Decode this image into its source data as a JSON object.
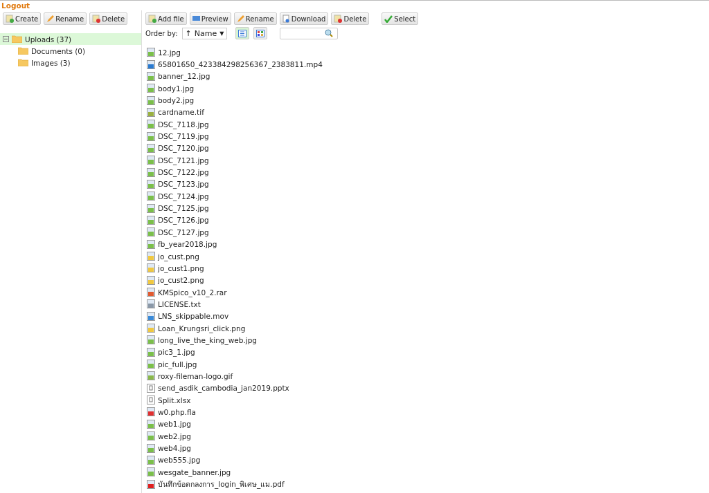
{
  "logout": "Logout",
  "dir_toolbar": [
    {
      "kind": "create",
      "label": "Create"
    },
    {
      "kind": "rename",
      "label": "Rename"
    },
    {
      "kind": "delete",
      "label": "Delete"
    }
  ],
  "tree": [
    {
      "label": "Uploads (37)",
      "selected": true,
      "expanded": true,
      "children": [
        {
          "label": "Documents (0)",
          "selected": false
        },
        {
          "label": "Images (3)",
          "selected": false
        }
      ]
    }
  ],
  "file_toolbar": [
    {
      "kind": "add",
      "label": "Add file"
    },
    {
      "kind": "preview",
      "label": "Preview"
    },
    {
      "kind": "rename",
      "label": "Rename"
    },
    {
      "kind": "download",
      "label": "Download"
    },
    {
      "kind": "delete",
      "label": "Delete"
    },
    {
      "kind": "select",
      "label": "Select"
    }
  ],
  "order": {
    "label": "Order by:",
    "arrow": "↑",
    "value": "Name",
    "caret": "▼"
  },
  "views": [
    {
      "kind": "list",
      "selected": true
    },
    {
      "kind": "thumbs",
      "selected": false
    }
  ],
  "files": [
    {
      "name": "12.jpg",
      "kind": "image"
    },
    {
      "name": "65801650_423384298256367_2383811.mp4",
      "kind": "video"
    },
    {
      "name": "banner_12.jpg",
      "kind": "image"
    },
    {
      "name": "body1.jpg",
      "kind": "image"
    },
    {
      "name": "body2.jpg",
      "kind": "image"
    },
    {
      "name": "cardname.tif",
      "kind": "tif"
    },
    {
      "name": "DSC_7118.jpg",
      "kind": "image"
    },
    {
      "name": "DSC_7119.jpg",
      "kind": "image"
    },
    {
      "name": "DSC_7120.jpg",
      "kind": "image"
    },
    {
      "name": "DSC_7121.jpg",
      "kind": "image"
    },
    {
      "name": "DSC_7122.jpg",
      "kind": "image"
    },
    {
      "name": "DSC_7123.jpg",
      "kind": "image"
    },
    {
      "name": "DSC_7124.jpg",
      "kind": "image"
    },
    {
      "name": "DSC_7125.jpg",
      "kind": "image"
    },
    {
      "name": "DSC_7126.jpg",
      "kind": "image"
    },
    {
      "name": "DSC_7127.jpg",
      "kind": "image"
    },
    {
      "name": "fb_year2018.jpg",
      "kind": "image"
    },
    {
      "name": "jo_cust.png",
      "kind": "png"
    },
    {
      "name": "jo_cust1.png",
      "kind": "png"
    },
    {
      "name": "jo_cust2.png",
      "kind": "png"
    },
    {
      "name": "KMSpico_v10_2.rar",
      "kind": "archive"
    },
    {
      "name": "LICENSE.txt",
      "kind": "text"
    },
    {
      "name": "LNS_skippable.mov",
      "kind": "movie"
    },
    {
      "name": "Loan_Krungsri_click.png",
      "kind": "png"
    },
    {
      "name": "long_live_the_king_web.jpg",
      "kind": "image"
    },
    {
      "name": "pic3_1.jpg",
      "kind": "image"
    },
    {
      "name": "pic_full.jpg",
      "kind": "image"
    },
    {
      "name": "roxy-fileman-logo.gif",
      "kind": "gif"
    },
    {
      "name": "send_asdik_cambodia_jan2019.pptx",
      "kind": "unknown"
    },
    {
      "name": "Split.xlsx",
      "kind": "unknown"
    },
    {
      "name": "w0.php.fla",
      "kind": "flash"
    },
    {
      "name": "web1.jpg",
      "kind": "image"
    },
    {
      "name": "web2.jpg",
      "kind": "image"
    },
    {
      "name": "web4.jpg",
      "kind": "image"
    },
    {
      "name": "web555.jpg",
      "kind": "image"
    },
    {
      "name": "wesgate_banner.jpg",
      "kind": "image"
    },
    {
      "name": "บันทึกข้อตกลงการ_login_พิเศษ_แม.pdf",
      "kind": "pdf"
    }
  ]
}
